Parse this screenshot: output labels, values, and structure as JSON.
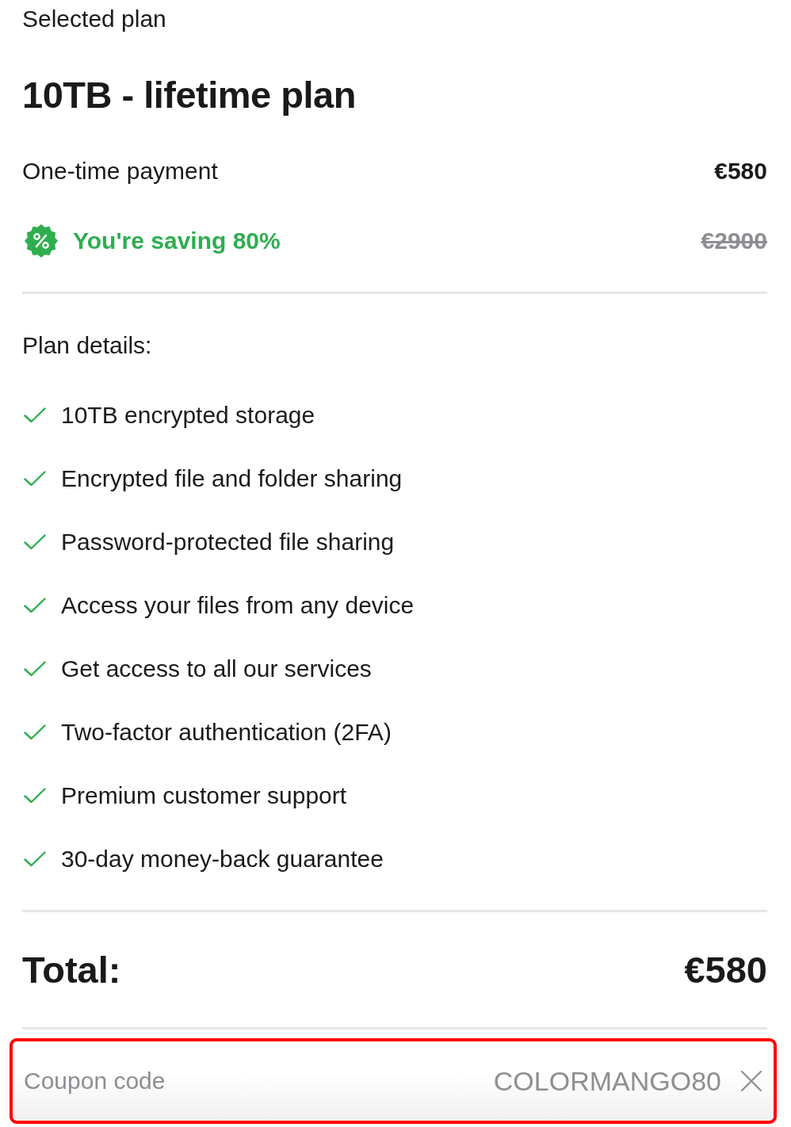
{
  "header": {
    "label": "Selected plan",
    "title": "10TB - lifetime plan"
  },
  "payment": {
    "label": "One-time payment",
    "price": "€580"
  },
  "saving": {
    "label": "You're saving 80%",
    "original_price": "€2900"
  },
  "plan_details": {
    "heading": "Plan details:",
    "features": [
      "10TB encrypted storage",
      "Encrypted file and folder sharing",
      "Password-protected file sharing",
      "Access your files from any device",
      "Get access to all our services",
      "Two-factor authentication (2FA)",
      "Premium customer support",
      "30-day money-back guarantee"
    ]
  },
  "total": {
    "label": "Total:",
    "price": "€580"
  },
  "coupon": {
    "label": "Coupon code",
    "value": "COLORMANGO80",
    "highlighted": true
  }
}
